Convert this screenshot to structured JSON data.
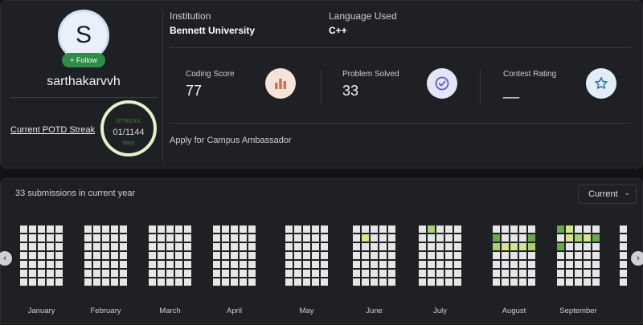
{
  "profile": {
    "avatar_letter": "S",
    "follow_label": "+ Follow",
    "username": "sarthakarvvh",
    "potd_label": "Current POTD Streak",
    "streak_label": "STREAK",
    "streak_value": "01",
    "streak_max": "/1144",
    "streak_unit": "days"
  },
  "info": {
    "institution_label": "Institution",
    "institution_value": "Bennett University",
    "language_label": "Language Used",
    "language_value": "C++"
  },
  "stats": [
    {
      "label": "Coding Score",
      "value": "77",
      "icon": "bar-chart-icon"
    },
    {
      "label": "Problem Solved",
      "value": "33",
      "icon": "check-circle-icon"
    },
    {
      "label": "Contest Rating",
      "value": "__",
      "icon": "star-icon"
    }
  ],
  "ambassador_label": "Apply for Campus Ambassador",
  "heatmap": {
    "submissions_text": "33 submissions in current year",
    "year_selected": "Current",
    "colors": {
      "empty": "#e6e6e6",
      "low": "#d4e686",
      "mid": "#a8d26f",
      "high": "#6aa84f"
    },
    "months": [
      {
        "name": "January",
        "cols": 5,
        "active": {}
      },
      {
        "name": "February",
        "cols": 5,
        "active": {}
      },
      {
        "name": "March",
        "cols": 5,
        "active": {}
      },
      {
        "name": "April",
        "cols": 5,
        "active": {}
      },
      {
        "name": "May",
        "cols": 5,
        "active": {}
      },
      {
        "name": "June",
        "cols": 5,
        "active": {
          "1-1": "low"
        }
      },
      {
        "name": "July",
        "cols": 5,
        "active": {
          "1-0": "mid",
          "5-1": "mid"
        }
      },
      {
        "name": "August",
        "cols": 5,
        "active": {
          "0-1": "high",
          "0-2": "mid",
          "1-2": "low",
          "2-2": "low",
          "3-2": "low",
          "4-1": "high",
          "4-2": "mid",
          "5-0": "low",
          "5-1": "low",
          "6-0": "low",
          "6-1": "low"
        }
      },
      {
        "name": "September",
        "cols": 5,
        "active": {
          "0-0": "high",
          "0-2": "high",
          "1-0": "low",
          "1-1": "low",
          "2-1": "mid",
          "3-1": "low",
          "4-1": "high",
          "5-1": "low"
        }
      },
      {
        "name": "",
        "cols": 1,
        "active": {}
      }
    ]
  }
}
